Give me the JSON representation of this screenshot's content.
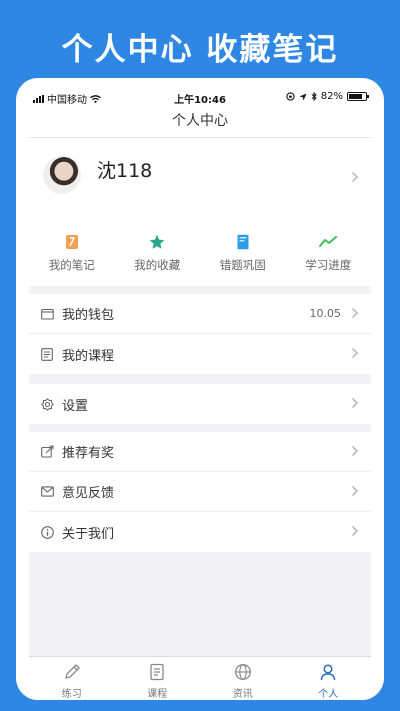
{
  "headline": "个人中心 收藏笔记",
  "status": {
    "carrier": "中国移动",
    "time": "上午10:46",
    "battery": "82%",
    "battery_level": 0.82
  },
  "nav": {
    "title": "个人中心"
  },
  "profile": {
    "username": "沈118"
  },
  "quick_actions": [
    {
      "label": "我的笔记",
      "icon": "notebook-icon",
      "color": "#f0a155"
    },
    {
      "label": "我的收藏",
      "icon": "star-icon",
      "color": "#2aa68c"
    },
    {
      "label": "错题巩固",
      "icon": "book-icon",
      "color": "#2f9be5"
    },
    {
      "label": "学习进度",
      "icon": "trend-icon",
      "color": "#3dbf59"
    }
  ],
  "menu": {
    "wallet": {
      "label": "我的钱包",
      "value": "10.05"
    },
    "courses": {
      "label": "我的课程"
    },
    "settings": {
      "label": "设置"
    },
    "recommend": {
      "label": "推荐有奖"
    },
    "feedback": {
      "label": "意见反馈"
    },
    "about": {
      "label": "关于我们"
    }
  },
  "tabs": [
    {
      "label": "练习",
      "icon": "pencil-icon"
    },
    {
      "label": "课程",
      "icon": "document-icon"
    },
    {
      "label": "资讯",
      "icon": "globe-icon"
    },
    {
      "label": "个人",
      "icon": "person-icon"
    }
  ],
  "colors": {
    "background": "#2f87e4",
    "active_tab": "#2f6db3"
  }
}
